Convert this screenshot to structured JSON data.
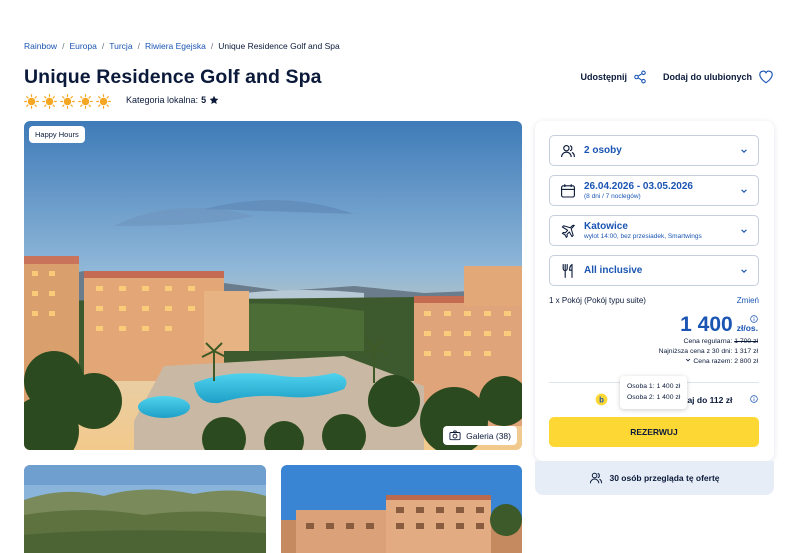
{
  "breadcrumb": [
    "Rainbow",
    "Europa",
    "Turcja",
    "Riwiera Egejska",
    "Unique Residence Golf and Spa"
  ],
  "hotel": {
    "title": "Unique Residence Golf and Spa",
    "sun_count": 5,
    "category_label": "Kategoria lokalna:",
    "category_value": "5"
  },
  "actions": {
    "share_label": "Udostępnij",
    "favorite_label": "Dodaj do ulubionych"
  },
  "gallery": {
    "badge": "Happy Hours",
    "gallery_button": "Galeria (38)"
  },
  "booking": {
    "guests": "2 osoby",
    "dates": "26.04.2026 - 03.05.2026",
    "dates_sub": "(8 dni / 7 noclegów)",
    "departure": "Katowice",
    "departure_sub": "wylot 14:00, bez przesiadek, Smartwings",
    "board": "All inclusive",
    "room": "1 x Pokój  (Pokój typu suite)",
    "change_label": "Zmień",
    "price": "1 400",
    "price_unit": "zł/os.",
    "regular_label": "Cena regularna:",
    "regular_price": "1 700 zł",
    "lowest_label": "Najniższa cena z 30 dni:",
    "lowest_price": "1 317 zł",
    "total_label": "Cena razem:",
    "total_price": "2 800 zł",
    "cashback": "skaj do 112 zł",
    "tooltip_person1": "Osoba 1: 1 400 zł",
    "tooltip_person2": "Osoba 2: 1 400 zł",
    "reserve_label": "REZERWUJ",
    "viewers": "30 osób przegląda tę ofertę"
  },
  "colors": {
    "brand_blue": "#1a55b3",
    "navy": "#0b1a3a",
    "reserve_yellow": "#fdd835",
    "sun_orange": "#f5a623"
  }
}
